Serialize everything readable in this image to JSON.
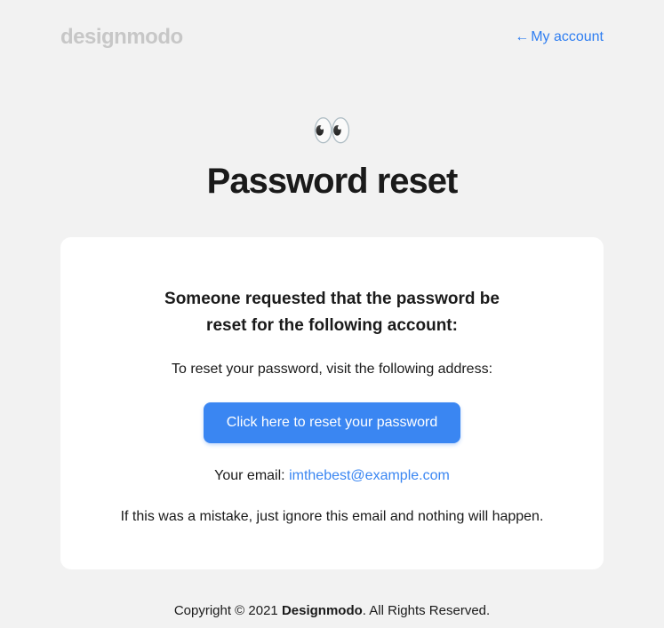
{
  "header": {
    "logo": "designmodo",
    "account_link_arrow": "←",
    "account_link_text": "My account"
  },
  "hero": {
    "icon": "👀",
    "title": "Password reset"
  },
  "card": {
    "heading_line1": "Someone requested that the password be",
    "heading_line2": "reset for the following account:",
    "instruction": "To reset your password, visit the following address:",
    "button_label": "Click here to reset your password",
    "email_prefix": "Your email: ",
    "email_value": "imthebest@example.com",
    "mistake_text": "If this was a mistake, just ignore this email and nothing will happen."
  },
  "footer": {
    "prefix": "Copyright © 2021 ",
    "brand": "Designmodo",
    "suffix": ". All Rights Reserved."
  }
}
